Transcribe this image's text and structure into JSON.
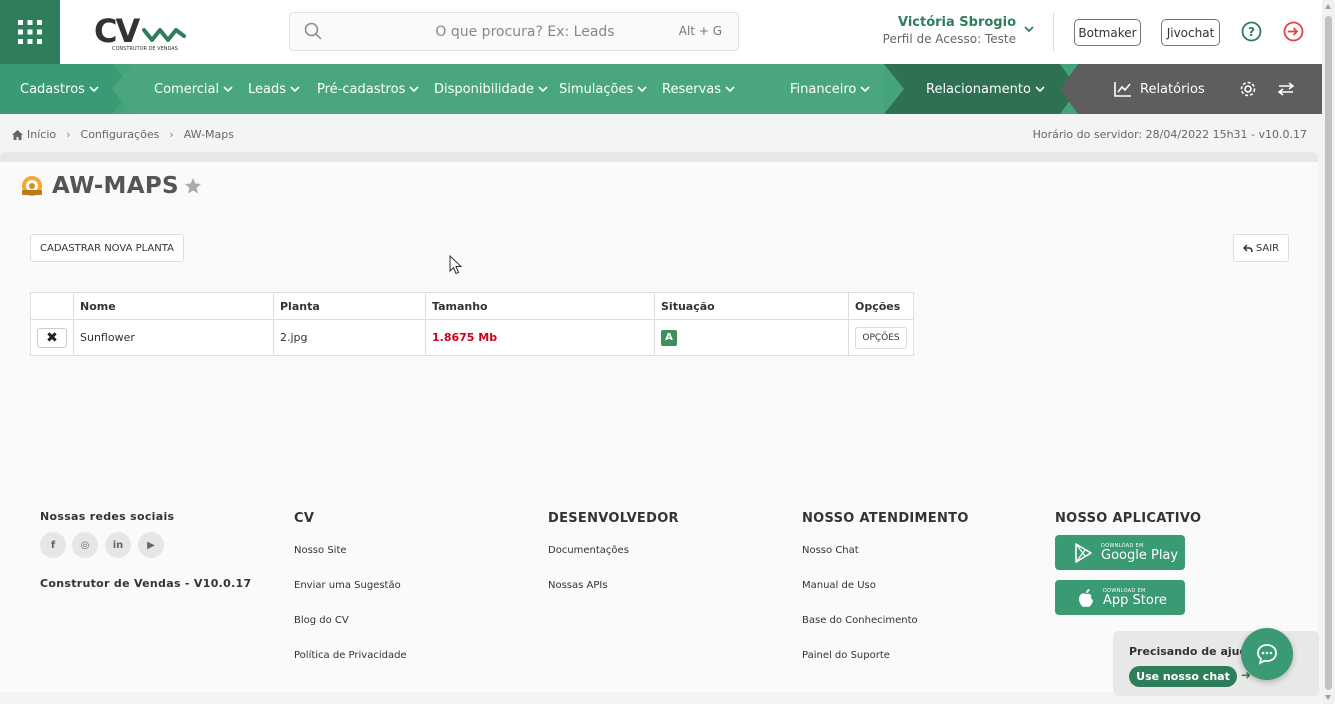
{
  "header": {
    "search_placeholder": "O que procura? Ex: Leads",
    "search_shortcut": "Alt + G",
    "user_name": "Victória Sbrogio",
    "user_profile": "Perfil de Acesso: Teste",
    "botmaker_label": "Botmaker",
    "jivochat_label": "Jivochat",
    "logo_text": "CV",
    "logo_tagline": "CONSTRUTOR DE VENDAS"
  },
  "nav": {
    "items": [
      {
        "label": "Cadastros"
      },
      {
        "label": "Comercial"
      },
      {
        "label": "Leads"
      },
      {
        "label": "Pré-cadastros"
      },
      {
        "label": "Disponibilidade"
      },
      {
        "label": "Simulações"
      },
      {
        "label": "Reservas"
      },
      {
        "label": "Financeiro"
      },
      {
        "label": "Relacionamento"
      }
    ],
    "reports_label": "Relatórios"
  },
  "breadcrumb": {
    "items": [
      "Início",
      "Configurações",
      "AW-Maps"
    ],
    "server_time": "Horário do servidor: 28/04/2022 15h31 - v10.0.17"
  },
  "page": {
    "title": "AW-MAPS",
    "new_button": "CADASTRAR NOVA PLANTA",
    "exit_button": "SAIR"
  },
  "table": {
    "columns": [
      "",
      "Nome",
      "Planta",
      "Tamanho",
      "Situação",
      "Opções"
    ],
    "rows": [
      {
        "name": "Sunflower",
        "file": "2.jpg",
        "size": "1.8675 Mb",
        "status": "A",
        "options": "OPÇÕES"
      }
    ]
  },
  "footer": {
    "social_title": "Nossas redes sociais",
    "social_icons": [
      "f",
      "◎",
      "in",
      "▶"
    ],
    "version": "Construtor de Vendas - V10.0.17",
    "cv": {
      "title": "CV",
      "links": [
        "Nosso Site",
        "Enviar uma Sugestão",
        "Blog do CV",
        "Política de Privacidade"
      ]
    },
    "dev": {
      "title": "DESENVOLVEDOR",
      "links": [
        "Documentações",
        "Nossas APIs"
      ]
    },
    "support": {
      "title": "NOSSO ATENDIMENTO",
      "links": [
        "Nosso Chat",
        "Manual de Uso",
        "Base do Conhecimento",
        "Painel do Suporte"
      ]
    },
    "app": {
      "title": "NOSSO APLICATIVO",
      "google": {
        "small": "DOWNLOAD EM",
        "big": "Google Play"
      },
      "apple": {
        "small": "DOWNLOAD EM",
        "big": "App Store"
      }
    }
  },
  "help": {
    "question": "Precisando de ajuda?",
    "chat_button": "Use nosso chat",
    "arrow": "➜"
  },
  "colors": {
    "brand_green": "#2e7d5b",
    "nav_green": "#44a37a",
    "nav_dark": "#2f6f52",
    "nav_gray": "#5e5e5e",
    "size_red": "#d0021b"
  }
}
